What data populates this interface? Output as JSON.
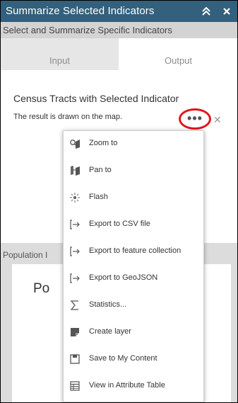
{
  "panel": {
    "title": "Summarize Selected Indicators",
    "subtitle": "Select and Summarize Specific Indicators",
    "tabs": [
      {
        "label": "Input",
        "active": false
      },
      {
        "label": "Output",
        "active": true
      }
    ]
  },
  "result": {
    "title": "Census Tracts with Selected Indicator",
    "description": "The result is drawn on the map.",
    "more_label": "•••",
    "close_label": "✕"
  },
  "lower": {
    "section_label": "Population I",
    "card_text": "Po"
  },
  "menu": {
    "items": [
      {
        "label": "Zoom to",
        "icon": "zoom-to-icon"
      },
      {
        "label": "Pan to",
        "icon": "pan-to-icon"
      },
      {
        "label": "Flash",
        "icon": "flash-icon"
      },
      {
        "label": "Export to CSV file",
        "icon": "export-icon"
      },
      {
        "label": "Export to feature collection",
        "icon": "export-icon"
      },
      {
        "label": "Export to GeoJSON",
        "icon": "export-icon"
      },
      {
        "label": "Statistics...",
        "icon": "statistics-icon"
      },
      {
        "label": "Create layer",
        "icon": "create-layer-icon"
      },
      {
        "label": "Save to My Content",
        "icon": "save-icon"
      },
      {
        "label": "View in Attribute Table",
        "icon": "table-icon"
      }
    ]
  },
  "colors": {
    "titlebar": "#33607c",
    "highlight_ring": "#e3141c"
  }
}
